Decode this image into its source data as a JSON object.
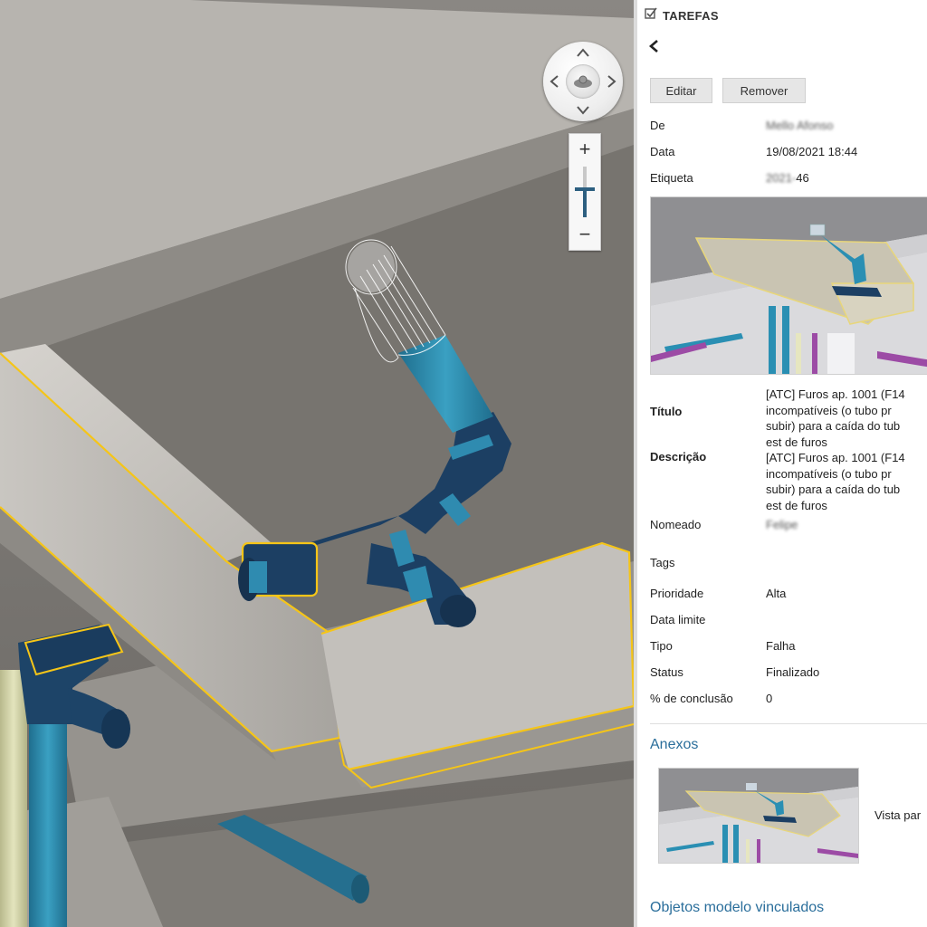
{
  "panel": {
    "title": "TAREFAS",
    "edit_label": "Editar",
    "remove_label": "Remover",
    "fields": {
      "from_label": "De",
      "from_value": "Mello Afonso",
      "date_label": "Data",
      "date_value": "19/08/2021 18:44",
      "tag_label": "Etiqueta",
      "tag_value_prefix": "2021-",
      "tag_value_suffix": "46",
      "title_label": "Título",
      "title_lines": [
        "[ATC] Furos ap. 1001 (F14",
        "incompatíveis (o tubo pr",
        "subir) para a caída do tub",
        "est de furos"
      ],
      "description_label": "Descrição",
      "description_lines": [
        "[ATC] Furos ap. 1001 (F14",
        "incompatíveis (o tubo pr",
        "subir) para a caída do tub",
        "est de furos"
      ],
      "assigned_label": "Nomeado",
      "assigned_value": "Felipe",
      "tags_label": "Tags",
      "priority_label": "Prioridade",
      "priority_value": "Alta",
      "deadline_label": "Data limite",
      "type_label": "Tipo",
      "type_value": "Falha",
      "status_label": "Status",
      "status_value": "Finalizado",
      "completion_label": "% de conclusão",
      "completion_value": "0"
    },
    "attachments_title": "Anexos",
    "attachment_caption": "Vista par",
    "linked_objects_title": "Objetos modelo vinculados"
  },
  "viewer": {
    "zoom_plus": "+",
    "zoom_minus": "−",
    "zoom_level": 0.55
  },
  "colors": {
    "pipe_blue": "#2f7fa0",
    "pipe_dark": "#1c3f63",
    "highlight": "#f5c518",
    "link": "#2a6e9b"
  }
}
